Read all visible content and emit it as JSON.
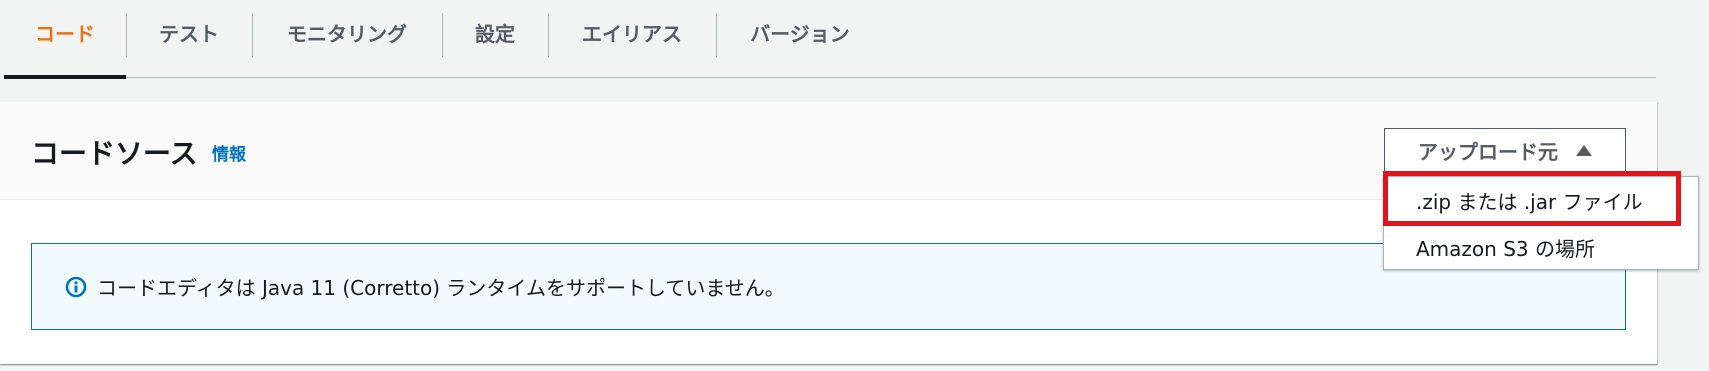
{
  "tabs": [
    {
      "label": "コード",
      "active": true
    },
    {
      "label": "テスト"
    },
    {
      "label": "モニタリング"
    },
    {
      "label": "設定"
    },
    {
      "label": "エイリアス"
    },
    {
      "label": "バージョン"
    }
  ],
  "panel": {
    "title": "コードソース",
    "info_link": "情報",
    "upload_button": {
      "label": "アップロード元",
      "icon": "caret-up-icon"
    }
  },
  "dropdown": {
    "items": [
      {
        "label": ".zip または .jar ファイル"
      },
      {
        "label": "Amazon S3 の場所"
      }
    ]
  },
  "alert": {
    "icon": "info-circle-icon",
    "text": "コードエディタは Java 11 (Corretto) ランタイムをサポートしていません。"
  },
  "colors": {
    "accent": "#ec7211",
    "link": "#0073bb",
    "highlight": "#e0161e",
    "info_bg": "#f1faff"
  }
}
